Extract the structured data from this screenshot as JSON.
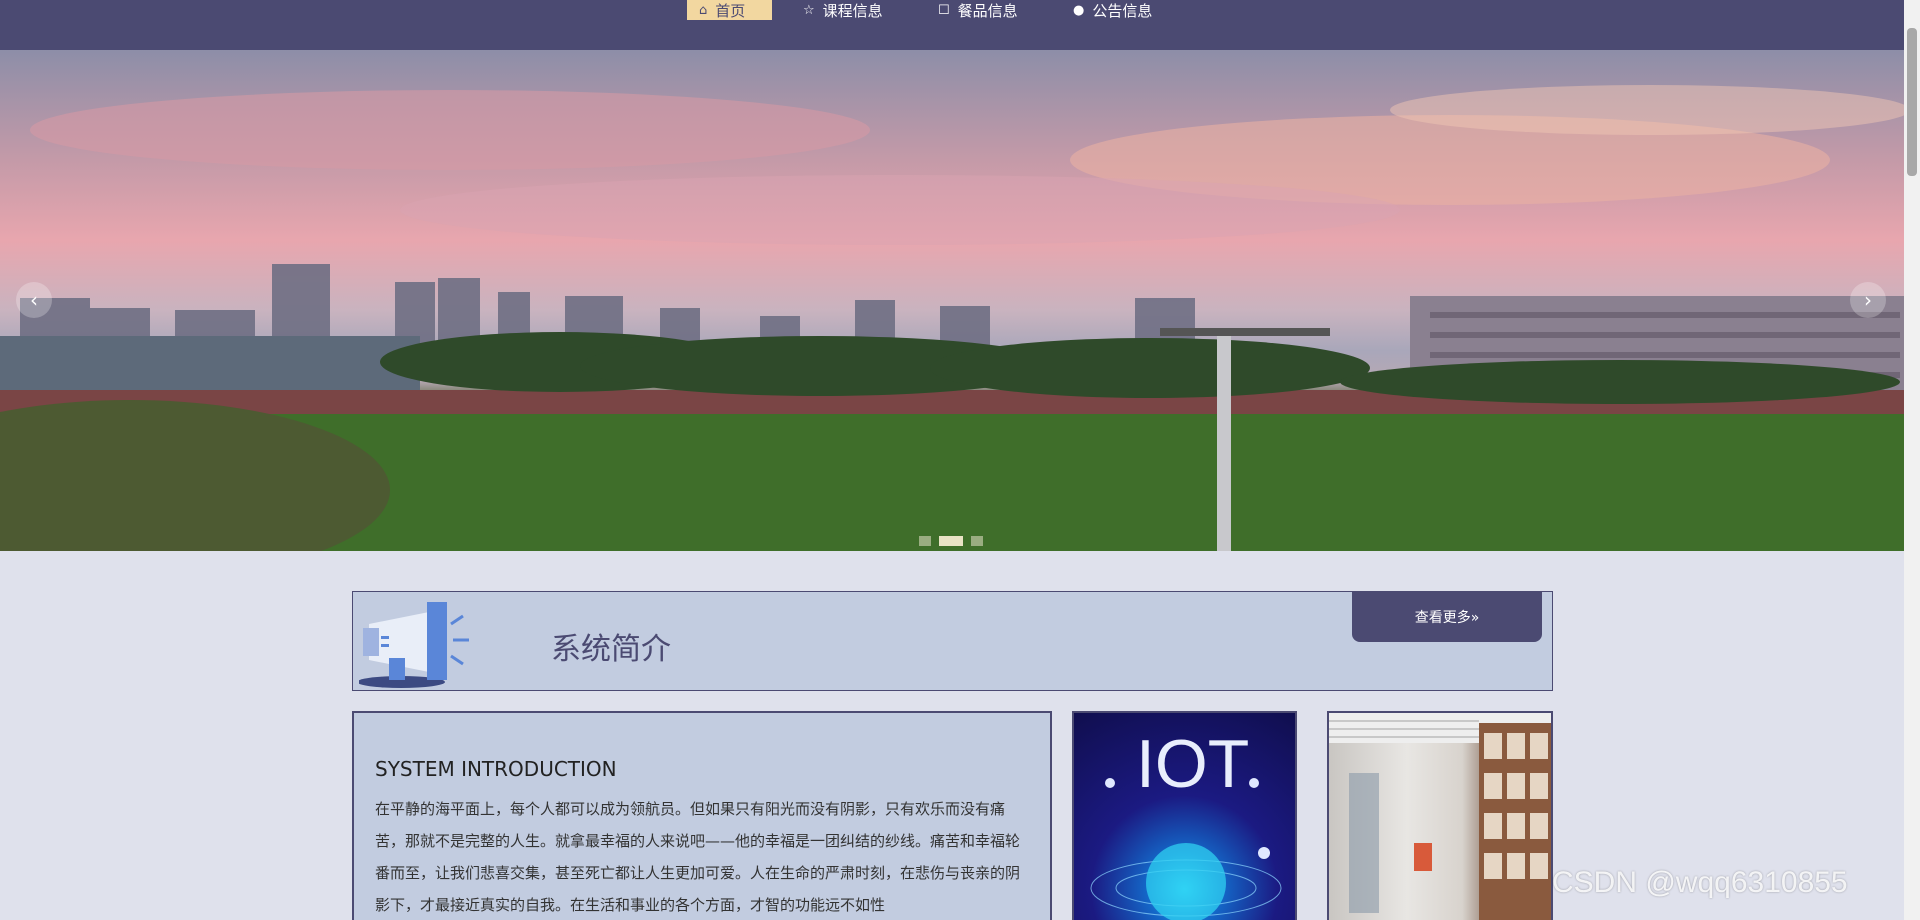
{
  "nav": {
    "items": [
      {
        "label": "首页",
        "icon": "home-icon",
        "active": true
      },
      {
        "label": "课程信息",
        "icon": "star-icon",
        "active": false
      },
      {
        "label": "餐品信息",
        "icon": "square-icon",
        "active": false
      },
      {
        "label": "公告信息",
        "icon": "info-icon",
        "active": false
      }
    ]
  },
  "banner": {
    "prev": "‹",
    "next": "›",
    "slide_count": 3,
    "active_slide": 2
  },
  "intro": {
    "title": "系统简介",
    "more_label": "查看更多»",
    "heading_en": "SYSTEM INTRODUCTION",
    "body": "在平静的海平面上，每个人都可以成为领航员。但如果只有阳光而没有阴影，只有欢乐而没有痛苦，那就不是完整的人生。就拿最幸福的人来说吧——他的幸福是一团纠结的纱线。痛苦和幸福轮番而至，让我们悲喜交集，甚至死亡都让人生更加可爱。人在生命的严肃时刻，在悲伤与丧亲的阴影下，才最接近真实的自我。在生活和事业的各个方面，才智的功能远不如性"
  },
  "images": {
    "iot_label": "IOT"
  },
  "watermark": "CSDN @wqq6310855",
  "colors": {
    "primary": "#4b4a72",
    "accent": "#f2d7a0",
    "panel": "#c2cce0"
  }
}
